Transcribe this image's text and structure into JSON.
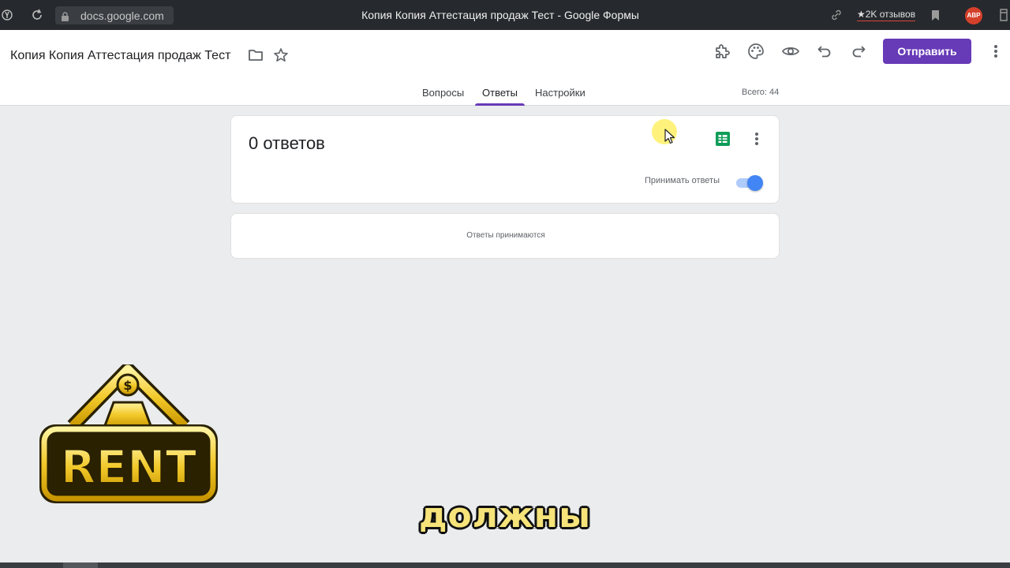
{
  "browser": {
    "url": "docs.google.com",
    "window_title": "Копия Копия Аттестация продаж Тест - Google Формы",
    "reviews": "★2K отзывов",
    "abp_badge": "ABP"
  },
  "header": {
    "doc_title": "Копия Копия Аттестация продаж Тест",
    "send_label": "Отправить"
  },
  "tabs": [
    {
      "label": "Вопросы",
      "active": false
    },
    {
      "label": "Ответы",
      "active": true
    },
    {
      "label": "Настройки",
      "active": false
    }
  ],
  "total": "Всего: 44",
  "responses": {
    "count_title": "0 ответов",
    "accept_label": "Принимать ответы",
    "accept_on": true,
    "status_text": "Ответы принимаются"
  },
  "overlay": {
    "caption": "должны",
    "logo_text": "RENT",
    "logo_symbol": "$"
  },
  "colors": {
    "accent": "#673ab7",
    "toggle_on": "#4285f4",
    "sheets_green": "#0f9d58",
    "caption_yellow": "#f6e37a"
  }
}
